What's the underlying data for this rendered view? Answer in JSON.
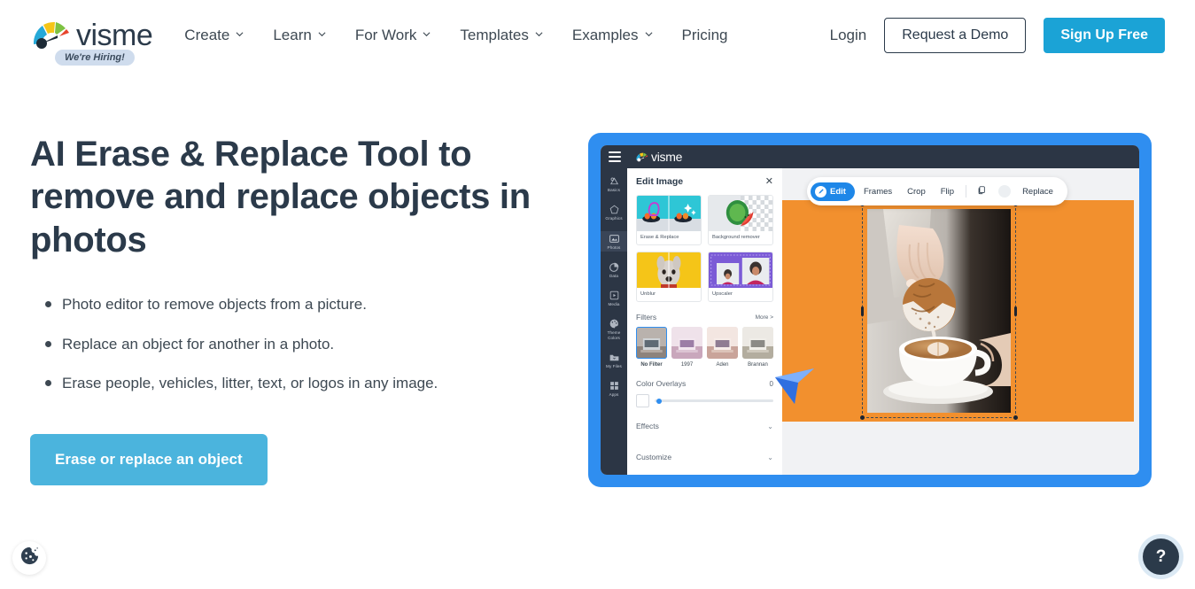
{
  "header": {
    "brand": {
      "name": "visme",
      "logo_icon": "visme-fan-logo-icon"
    },
    "hiring_badge": "We're Hiring!",
    "nav": [
      {
        "label": "Create",
        "has_dropdown": true
      },
      {
        "label": "Learn",
        "has_dropdown": true
      },
      {
        "label": "For Work",
        "has_dropdown": true
      },
      {
        "label": "Templates",
        "has_dropdown": true
      },
      {
        "label": "Examples",
        "has_dropdown": true
      },
      {
        "label": "Pricing",
        "has_dropdown": false
      }
    ],
    "login_label": "Login",
    "demo_label": "Request a Demo",
    "signup_label": "Sign Up Free"
  },
  "hero": {
    "title": "AI Erase & Replace Tool to remove and replace objects in photos",
    "bullets": [
      "Photo editor to remove objects from a picture.",
      "Replace an object for another in a photo.",
      "Erase people, vehicles, litter, text, or logos in any image."
    ],
    "cta_label": "Erase or replace an object"
  },
  "mockup": {
    "app_name": "visme",
    "menu_icon": "hamburger-menu-icon",
    "rail": [
      {
        "label": "Basics",
        "icon": "basics-icon",
        "active": false
      },
      {
        "label": "Graphics",
        "icon": "graphics-icon",
        "active": false
      },
      {
        "label": "Photos",
        "icon": "photos-icon",
        "active": true
      },
      {
        "label": "Data",
        "icon": "data-chart-icon",
        "active": false
      },
      {
        "label": "Media",
        "icon": "media-icon",
        "active": false
      },
      {
        "label": "Theme Colors",
        "icon": "theme-colors-icon",
        "active": false
      },
      {
        "label": "My Files",
        "icon": "my-files-icon",
        "active": false
      },
      {
        "label": "Apps",
        "icon": "apps-grid-icon",
        "active": false
      }
    ],
    "panel": {
      "title": "Edit Image",
      "close_icon": "close-icon",
      "cards": [
        {
          "label": "Erase & Replace"
        },
        {
          "label": "Background remover"
        },
        {
          "label": "Unblur"
        },
        {
          "label": "Upscaler"
        }
      ],
      "filters": {
        "title": "Filters",
        "more_label": "More >",
        "items": [
          {
            "label": "No Filter",
            "active": true
          },
          {
            "label": "1997",
            "active": false
          },
          {
            "label": "Aden",
            "active": false
          },
          {
            "label": "Brannan",
            "active": false
          }
        ]
      },
      "color_overlays": {
        "label": "Color Overlays",
        "value": "0"
      },
      "accordions": [
        {
          "label": "Effects"
        },
        {
          "label": "Customize"
        }
      ]
    },
    "toolbar": {
      "edit_label": "Edit",
      "edit_icon": "pencil-icon",
      "items": [
        "Frames",
        "Crop",
        "Flip"
      ],
      "copy_icon": "duplicate-icon",
      "replace_label": "Replace"
    },
    "canvas": {
      "background_color": "#f2902e",
      "image_alt": "hand dipping biscotti into latte"
    }
  },
  "floating": {
    "cookie_icon": "cookie-consent-icon",
    "help_label": "?"
  },
  "colors": {
    "brand_blue": "#1ba3d6",
    "cta_blue": "#4bb4dd",
    "mockup_frame": "#2f8ef0",
    "dark_navy": "#2b3a4a",
    "canvas_orange": "#f2902e"
  }
}
